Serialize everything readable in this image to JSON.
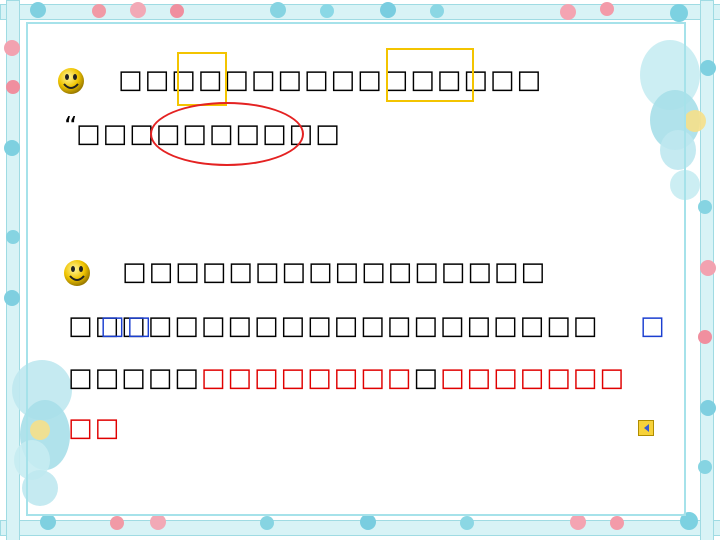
{
  "line1": {
    "text": "□□□□□□□□□□□□□□□□"
  },
  "line2": {
    "quote": "“",
    "text": "□□□□□□□□□□"
  },
  "line3": {
    "text": "□□□□□□□□□□□□□□□□"
  },
  "line4": {
    "text_start": "□□",
    "text_rest": "□□□□□□□□□□□□□□□□□□",
    "right_mark": "□"
  },
  "line5": {
    "text_plain": "□□□□□",
    "text_red1": "□□□□□□□□",
    "text_mid": "□",
    "text_red2": "□□□□□□□"
  },
  "line6": {
    "text_red": "□□"
  },
  "icons": {
    "smiley": "smiley-face-icon",
    "nav": "back-arrow-icon"
  },
  "colors": {
    "highlight_box": "#f3c400",
    "circle": "#e42222",
    "emphasis_text": "#e00000",
    "blue_text": "#1b3fd0",
    "frame": "#a6e2ea"
  }
}
